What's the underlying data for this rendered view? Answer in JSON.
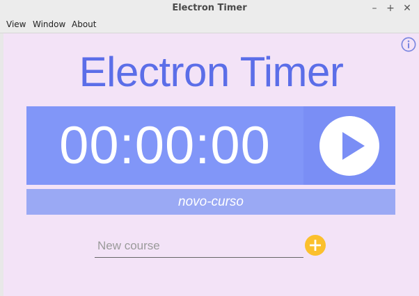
{
  "window": {
    "title": "Electron Timer",
    "controls": {
      "minimize": "–",
      "maximize": "+",
      "close": "✕"
    }
  },
  "menu": {
    "items": [
      {
        "label": "View"
      },
      {
        "label": "Window"
      },
      {
        "label": "About"
      }
    ]
  },
  "main": {
    "app_title": "Electron Timer",
    "timer": "00:00:00",
    "current_course": "novo-curso",
    "new_course_placeholder": "New course",
    "new_course_value": ""
  },
  "icons": {
    "info": "info-icon",
    "play": "play-icon",
    "add": "plus-icon"
  },
  "colors": {
    "background": "#f3e3f7",
    "title": "#5b6ee8",
    "timer_bg": "#8196f8",
    "play_bg": "#7a8ef5",
    "course_bg": "#9aa9f4",
    "add_button": "#fbc02d",
    "info_icon": "#7986e0"
  }
}
